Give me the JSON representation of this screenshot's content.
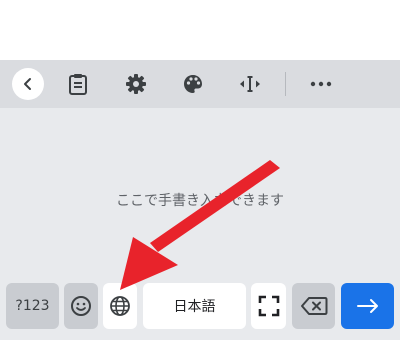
{
  "toolbar": {
    "icons": [
      "back-chevron-icon",
      "clipboard-icon",
      "gear-icon",
      "palette-icon",
      "text-cursor-move-icon",
      "more-horizontal-icon"
    ]
  },
  "handwriting": {
    "prompt": "ここで手書き入力できます"
  },
  "keys": {
    "symbols_label": "?123",
    "language_label": "日本語",
    "icons": [
      "emoji-icon",
      "globe-icon",
      "fullscreen-icon",
      "backspace-icon",
      "arrow-right-icon"
    ]
  },
  "colors": {
    "keyboard_bg": "#e8eaed",
    "toolbar_bg": "#dadce0",
    "dark_key": "#c9ccd1",
    "enter_key": "#1a73e8",
    "annotation_arrow": "#e8232b"
  }
}
